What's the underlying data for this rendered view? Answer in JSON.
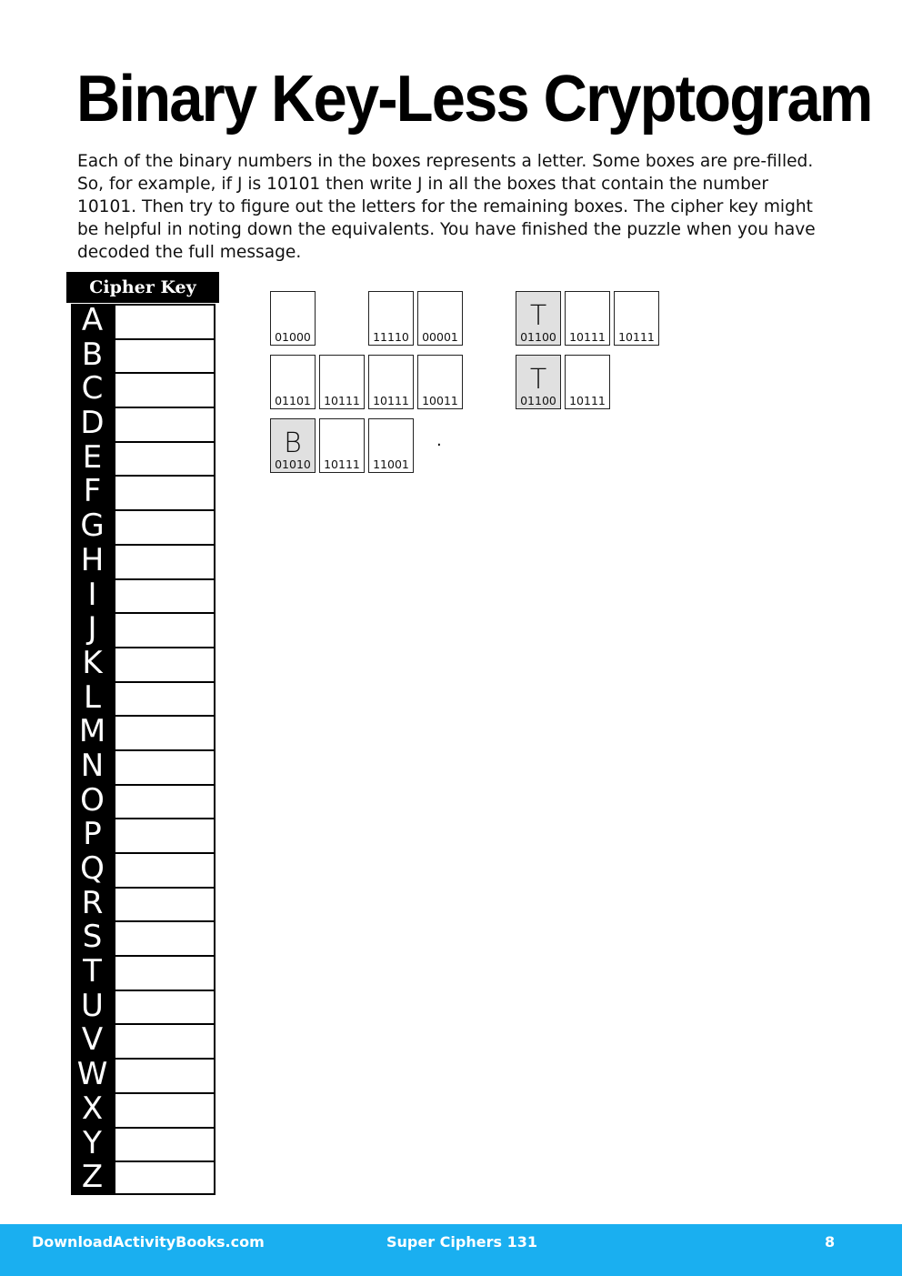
{
  "title": "Binary Key-Less Cryptogram",
  "instructions": "Each of the binary numbers in the boxes represents a letter. Some boxes are pre-filled. So, for example, if J is 10101 then write J in all the boxes that contain the number 10101. Then try to figure out the letters for the remaining boxes. The cipher key might be helpful in noting down the equivalents. You have finished the puzzle when you have decoded the full message.",
  "cipher_key": {
    "header": "Cipher Key",
    "letters": [
      "A",
      "B",
      "C",
      "D",
      "E",
      "F",
      "G",
      "H",
      "I",
      "J",
      "K",
      "L",
      "M",
      "N",
      "O",
      "P",
      "Q",
      "R",
      "S",
      "T",
      "U",
      "V",
      "W",
      "X",
      "Y",
      "Z"
    ],
    "values": [
      "",
      "",
      "",
      "",
      "",
      "",
      "",
      "",
      "",
      "",
      "",
      "",
      "",
      "",
      "",
      "",
      "",
      "",
      "",
      "",
      "",
      "",
      "",
      "",
      "",
      ""
    ]
  },
  "puzzle": {
    "rows": [
      [
        {
          "code": "01000",
          "letter": "",
          "prefilled": false,
          "col": 0
        },
        {
          "code": "11110",
          "letter": "",
          "prefilled": false,
          "col": 2
        },
        {
          "code": "00001",
          "letter": "",
          "prefilled": false,
          "col": 3
        },
        {
          "code": "01100",
          "letter": "T",
          "prefilled": true,
          "col": 5
        },
        {
          "code": "10111",
          "letter": "",
          "prefilled": false,
          "col": 6
        },
        {
          "code": "10111",
          "letter": "",
          "prefilled": false,
          "col": 7
        }
      ],
      [
        {
          "code": "01101",
          "letter": "",
          "prefilled": false,
          "col": 0
        },
        {
          "code": "10111",
          "letter": "",
          "prefilled": false,
          "col": 1
        },
        {
          "code": "10111",
          "letter": "",
          "prefilled": false,
          "col": 2
        },
        {
          "code": "10011",
          "letter": "",
          "prefilled": false,
          "col": 3
        },
        {
          "code": "01100",
          "letter": "T",
          "prefilled": true,
          "col": 5
        },
        {
          "code": "10111",
          "letter": "",
          "prefilled": false,
          "col": 6
        }
      ],
      [
        {
          "code": "01010",
          "letter": "B",
          "prefilled": true,
          "col": 0
        },
        {
          "code": "10111",
          "letter": "",
          "prefilled": false,
          "col": 1
        },
        {
          "code": "11001",
          "letter": "",
          "prefilled": false,
          "col": 2
        }
      ]
    ],
    "punctuation": "."
  },
  "footer": {
    "website": "DownloadActivityBooks.com",
    "book": "Super Ciphers 131",
    "page": "8"
  }
}
